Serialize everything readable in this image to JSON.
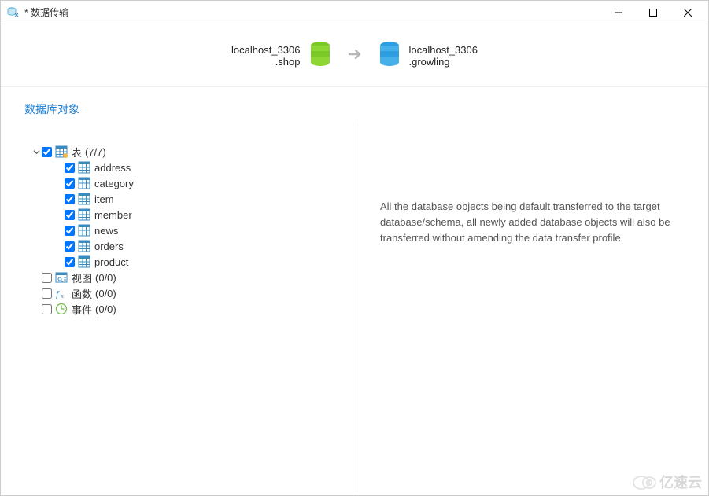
{
  "window": {
    "title": "* 数据传输"
  },
  "transfer": {
    "source": {
      "host": "localhost_3306",
      "db": ".shop"
    },
    "target": {
      "host": "localhost_3306",
      "db": ".growling"
    }
  },
  "section_title": "数据库对象",
  "tree": {
    "tables": {
      "label": "表",
      "count": "(7/7)",
      "items": [
        "address",
        "category",
        "item",
        "member",
        "news",
        "orders",
        "product"
      ]
    },
    "views": {
      "label": "视图",
      "count": "(0/0)"
    },
    "funcs": {
      "label": "函数",
      "count": "(0/0)"
    },
    "events": {
      "label": "事件",
      "count": "(0/0)"
    }
  },
  "right_message": "All the database objects being default transferred to the target database/schema, all newly added database objects will also be transferred without amending the data transfer profile.",
  "watermark": "亿速云"
}
